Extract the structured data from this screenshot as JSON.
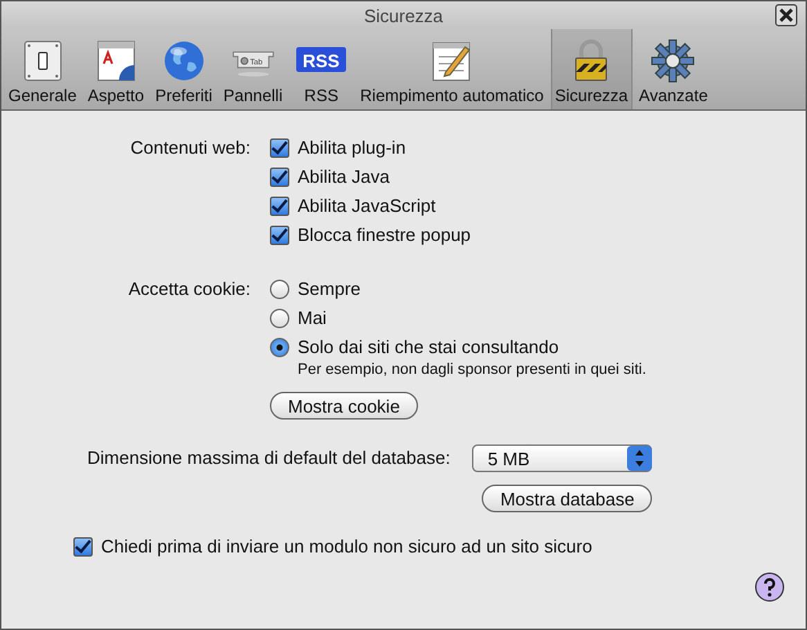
{
  "window": {
    "title": "Sicurezza"
  },
  "toolbar": [
    {
      "label": "Generale",
      "kind": "switch",
      "selected": false
    },
    {
      "label": "Aspetto",
      "kind": "document",
      "selected": false
    },
    {
      "label": "Preferiti",
      "kind": "globe",
      "selected": false
    },
    {
      "label": "Pannelli",
      "kind": "tab",
      "badge": "Tab",
      "selected": false
    },
    {
      "label": "RSS",
      "kind": "rss",
      "badge": "RSS",
      "selected": false
    },
    {
      "label": "Riempimento automatico",
      "kind": "form",
      "selected": false
    },
    {
      "label": "Sicurezza",
      "kind": "lock",
      "selected": true
    },
    {
      "label": "Avanzate",
      "kind": "gear",
      "selected": false
    }
  ],
  "web_content": {
    "label": "Contenuti web:",
    "options": [
      {
        "label": "Abilita plug-in",
        "checked": true
      },
      {
        "label": "Abilita Java",
        "checked": true
      },
      {
        "label": "Abilita JavaScript",
        "checked": true
      },
      {
        "label": "Blocca finestre popup",
        "checked": true
      }
    ]
  },
  "cookies": {
    "label": "Accetta cookie:",
    "options": [
      {
        "label": "Sempre",
        "selected": false
      },
      {
        "label": "Mai",
        "selected": false
      },
      {
        "label": "Solo dai siti che stai consultando",
        "selected": true,
        "note": "Per esempio, non dagli sponsor presenti in quei siti."
      }
    ],
    "button": "Mostra cookie"
  },
  "database": {
    "label": "Dimensione massima di default del database:",
    "value": "5 MB",
    "button": "Mostra database"
  },
  "confirm_insecure_form": {
    "label": "Chiedi prima di inviare un modulo non sicuro ad un sito sicuro",
    "checked": true
  }
}
